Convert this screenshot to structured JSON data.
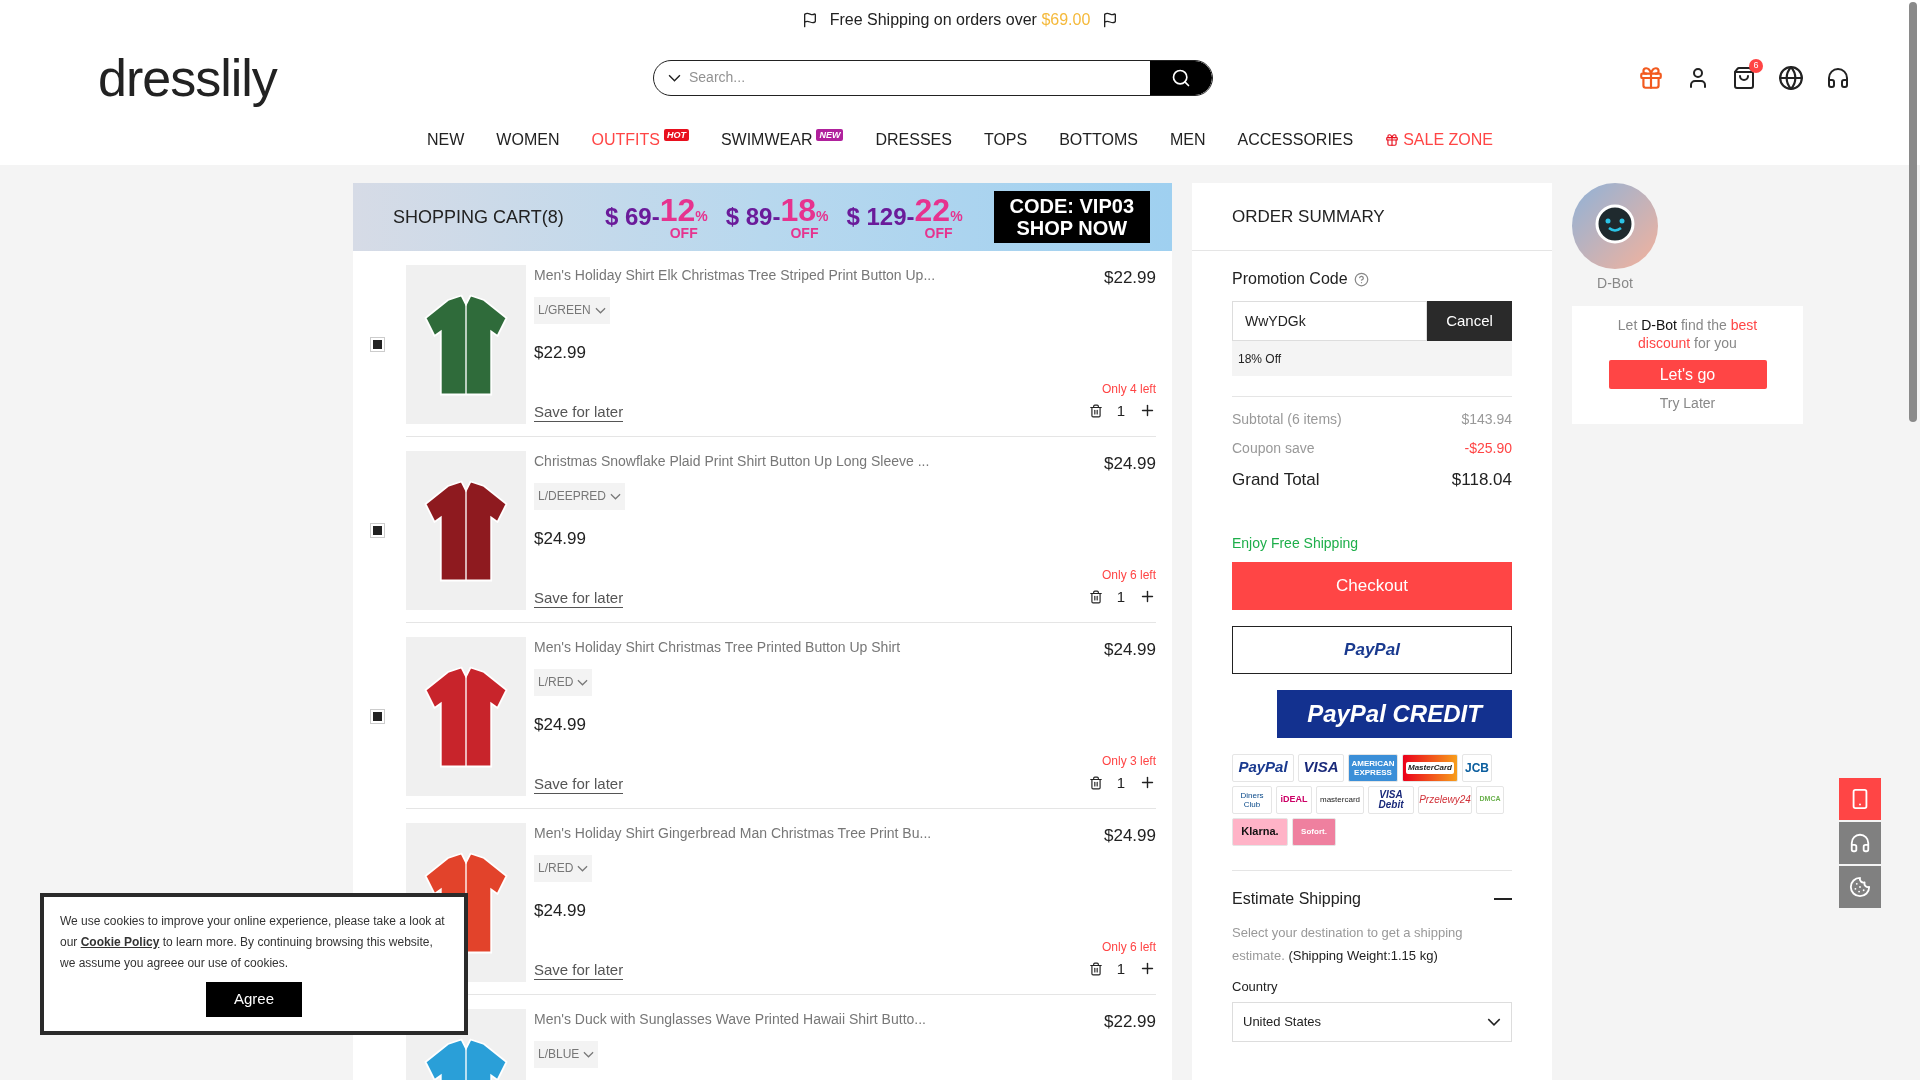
{
  "promo_bar": {
    "text": "Free Shipping on orders over",
    "amount": "$69.00"
  },
  "header": {
    "logo": "dresslily",
    "search": {
      "placeholder": "Search..."
    },
    "bag_count": "6"
  },
  "nav": [
    {
      "kind": "plain",
      "label": "NEW",
      "highlight": false
    },
    {
      "kind": "plain",
      "label": "WOMEN",
      "highlight": false
    },
    {
      "kind": "hot",
      "label": "OUTFITS",
      "highlight": true,
      "badge": "HOT"
    },
    {
      "kind": "new",
      "label": "SWIMWEAR",
      "highlight": false,
      "badge": "NEW"
    },
    {
      "kind": "plain",
      "label": "DRESSES",
      "highlight": false
    },
    {
      "kind": "plain",
      "label": "TOPS",
      "highlight": false
    },
    {
      "kind": "plain",
      "label": "BOTTOMS",
      "highlight": false
    },
    {
      "kind": "plain",
      "label": "MEN",
      "highlight": false
    },
    {
      "kind": "plain",
      "label": "ACCESSORIES",
      "highlight": false
    },
    {
      "kind": "sale",
      "label": "SALE ZONE",
      "highlight": true
    }
  ],
  "cart": {
    "title": "SHOPPING CART(8)",
    "banner": {
      "tiers": [
        {
          "threshold": "$ 69-",
          "discount": "12",
          "percent": "%",
          "off": "OFF"
        },
        {
          "threshold": "$ 89-",
          "discount": "18",
          "percent": "%",
          "off": "OFF"
        },
        {
          "threshold": "$ 129-",
          "discount": "22",
          "percent": "%",
          "off": "OFF"
        }
      ],
      "code": "CODE: VIP03",
      "cta": "SHOP NOW"
    },
    "items": [
      {
        "checked": true,
        "name": "Men's Holiday Shirt Elk Christmas Tree Striped Print Button Up...",
        "variant": "L/GREEN",
        "price": "$22.99",
        "unit_price": "$22.99",
        "save": "Save for later",
        "stock": "Only 4 left",
        "qty": "1"
      },
      {
        "checked": true,
        "name": "Christmas Snowflake Plaid Print Shirt Button Up Long Sleeve ...",
        "variant": "L/DEEPRED",
        "price": "$24.99",
        "unit_price": "$24.99",
        "save": "Save for later",
        "stock": "Only 6 left",
        "qty": "1"
      },
      {
        "checked": true,
        "name": "Men's Holiday Shirt Christmas Tree Printed Button Up Shirt",
        "variant": "L/RED",
        "price": "$24.99",
        "unit_price": "$24.99",
        "save": "Save for later",
        "stock": "Only 3 left",
        "qty": "1"
      },
      {
        "name": "Men's Holiday Shirt Gingerbread Man Christmas Tree Print Bu...",
        "variant": "L/RED",
        "price": "$24.99",
        "unit_price": "$24.99",
        "save": "Save for later",
        "stock": "Only 6 left",
        "qty": "1"
      },
      {
        "name": "Men's Duck with Sunglasses Wave Printed Hawaii Shirt Butto...",
        "variant": "L/BLUE",
        "price": "$22.99"
      }
    ]
  },
  "summary": {
    "title": "ORDER SUMMARY",
    "promo_label": "Promotion Code",
    "promo_value": "WwYDGk",
    "cancel": "Cancel",
    "promo_result": "18% Off",
    "lines": [
      {
        "kind": "muted",
        "label": "Subtotal (6 items)",
        "value": "$143.94"
      },
      {
        "kind": "discount",
        "label": "Coupon save",
        "value": "-$25.90"
      },
      {
        "kind": "total",
        "label": "Grand Total",
        "value": "$118.04"
      }
    ],
    "free_shipping": "Enjoy Free Shipping",
    "checkout": "Checkout",
    "paypal": "PayPal",
    "paypal_credit": "PayPal CREDIT",
    "payments": [
      {
        "kind": "paypal",
        "label": "PayPal"
      },
      {
        "kind": "visa",
        "label": "VISA"
      },
      {
        "kind": "amex",
        "label": "AMERICAN EXPRESS"
      },
      {
        "kind": "mastercard",
        "label": "MasterCard"
      },
      {
        "kind": "jcb",
        "label": "JCB"
      },
      {
        "kind": "diners",
        "label": "Diners Club"
      },
      {
        "kind": "ideal",
        "label": "iDEAL"
      },
      {
        "kind": "mc",
        "label": "mastercard"
      },
      {
        "kind": "visadebit",
        "label": "VISA Debit"
      },
      {
        "kind": "p24",
        "label": "Przelewy24"
      },
      {
        "kind": "dmca",
        "label": "DMCA"
      },
      {
        "kind": "klarna",
        "label": "Klarna."
      },
      {
        "kind": "sofort",
        "label": "Sofort."
      }
    ],
    "shipping": {
      "title": "Estimate Shipping",
      "expanded": true,
      "hint": "Select your destination to get a shipping estimate.",
      "weight": "(Shipping Weight:1.15 kg)",
      "country_label": "Country",
      "country": "United States"
    }
  },
  "dbot": {
    "name": "D-Bot",
    "message": [
      {
        "kind": "plain",
        "text": "Let"
      },
      {
        "kind": "bold",
        "text": "D-Bot"
      },
      {
        "kind": "plain",
        "text": "find the"
      },
      {
        "kind": "accent",
        "text": "best discount"
      },
      {
        "kind": "plain",
        "text": "for you"
      }
    ],
    "go": "Let's go",
    "later": "Try Later"
  },
  "cookie": {
    "before": "We use cookies to improve your online experience, please take a look at our",
    "link": "Cookie Policy",
    "after": "to learn more. By continuing browsing this website, we assume you agreee our use of cookies.",
    "button": "Agree"
  }
}
